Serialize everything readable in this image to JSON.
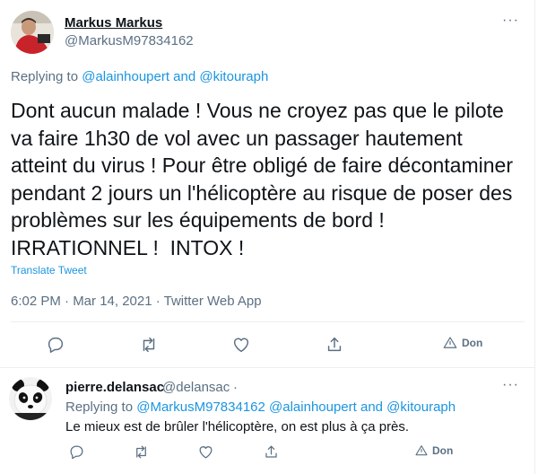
{
  "main_tweet": {
    "author_name": "Markus Markus",
    "author_handle": "@MarkusM97834162",
    "replying_to_prefix": "Replying to ",
    "replying_to_users": "@alainhoupert and @kitouraph",
    "text_lines": [
      "Dont aucun malade ! Vous ne croyez pas que le pilote",
      "va faire 1h30 de vol avec un passager hautement",
      "atteint du virus ! Pour être obligé de faire décontaminer",
      "pendant 2 jours un l'hélicoptère au risque de poser des",
      "problèmes sur les équipements de bord !",
      "IRRATIONNEL !  INTOX !"
    ],
    "translate_label": "Translate Tweet",
    "timestamp": "6:02 PM · Mar 14, 2021 · Twitter Web App",
    "actions": {
      "donate_label": "Don"
    },
    "icons": [
      "reply-icon",
      "retweet-icon",
      "like-icon",
      "share-icon",
      "donate-icon",
      "more-icon"
    ]
  },
  "reply_tweet": {
    "author_name": "pierre.delansac",
    "author_handle": "@delansac",
    "separator": "·",
    "replying_to_prefix": "Replying to ",
    "replying_to_users": "@MarkusM97834162 @alainhoupert and @kitouraph",
    "text": "Le mieux est de brûler l'hélicoptère, on est plus à ça près.",
    "actions": {
      "donate_label": "Don"
    }
  },
  "colors": {
    "text": "#0f1419",
    "secondary": "#5b7083",
    "link": "#1b95e0",
    "divider": "#ebeef0"
  }
}
